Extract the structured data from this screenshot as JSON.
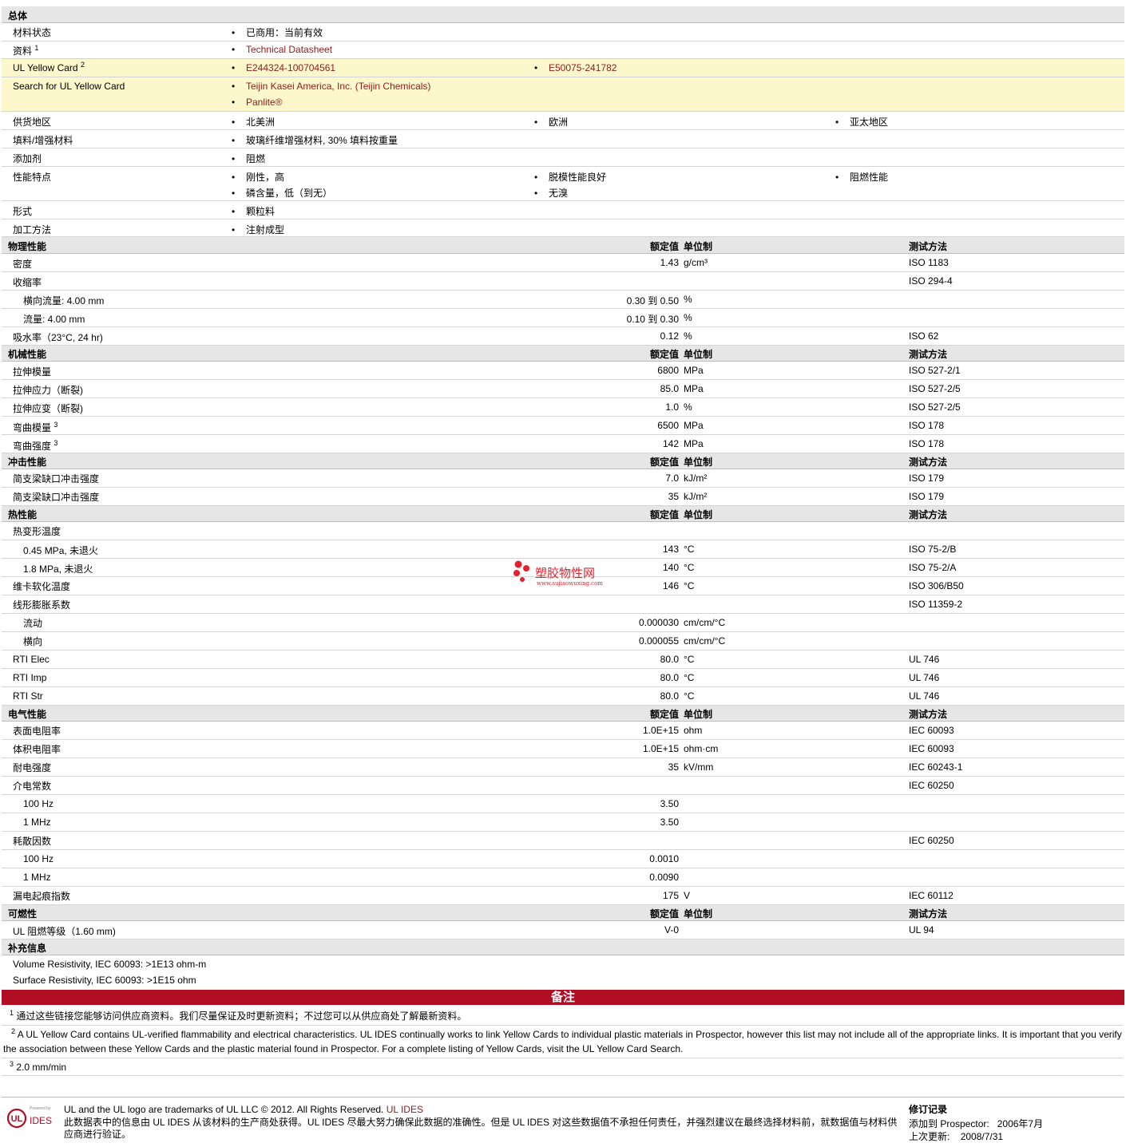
{
  "general": {
    "title": "总体",
    "rows": {
      "status_label": "材料状态",
      "status_val": "已商用：当前有效",
      "data_label": "资料",
      "data_sup": "1",
      "data_val": "Technical Datasheet",
      "yc_label": "UL Yellow Card",
      "yc_sup": "2",
      "yc_val1": "E244324-100704561",
      "yc_val2": "E50075-241782",
      "search_label": "Search for UL Yellow Card",
      "search_val1": "Teijin Kasei America, Inc. (Teijin Chemicals)",
      "search_val2": "Panlite®",
      "region_label": "供货地区",
      "region_1": "北美洲",
      "region_2": "欧洲",
      "region_3": "亚太地区",
      "filler_label": "填料/增强材料",
      "filler_val": "玻璃纤维增强材料, 30% 填料按重量",
      "additive_label": "添加剂",
      "additive_val": "阻燃",
      "features_label": "性能特点",
      "feat_1": "刚性，高",
      "feat_2": "脱模性能良好",
      "feat_3": "阻燃性能",
      "feat_4": "磷含量，低（到无）",
      "feat_5": "无溴",
      "form_label": "形式",
      "form_val": "颗粒料",
      "process_label": "加工方法",
      "process_val": "注射成型"
    }
  },
  "headers": {
    "nominal": "额定值",
    "unit": "单位制",
    "method": "测试方法"
  },
  "physical": {
    "title": "物理性能",
    "density_label": "密度",
    "density_val": "1.43",
    "density_unit": "g/cm³",
    "density_m": "ISO 1183",
    "shrink_label": "收缩率",
    "shrink_m": "ISO 294-4",
    "shrink_t_label": "横向流量: 4.00 mm",
    "shrink_t_val": "0.30 到  0.50",
    "shrink_t_unit": "%",
    "shrink_f_label": "流量: 4.00 mm",
    "shrink_f_val": "0.10 到  0.30",
    "shrink_f_unit": "%",
    "water_label": "吸水率（23°C, 24 hr)",
    "water_val": "0.12",
    "water_unit": "%",
    "water_m": "ISO 62"
  },
  "mechanical": {
    "title": "机械性能",
    "tm_label": "拉伸模量",
    "tm_val": "6800",
    "tm_unit": "MPa",
    "tm_m": "ISO 527-2/1",
    "ts_label": "拉伸应力（断裂)",
    "ts_val": "85.0",
    "ts_unit": "MPa",
    "ts_m": "ISO 527-2/5",
    "te_label": "拉伸应变（断裂)",
    "te_val": "1.0",
    "te_unit": "%",
    "te_m": "ISO 527-2/5",
    "fm_label": "弯曲模量",
    "fm_sup": "3",
    "fm_val": "6500",
    "fm_unit": "MPa",
    "fm_m": "ISO 178",
    "fs_label": "弯曲强度",
    "fs_sup": "3",
    "fs_val": "142",
    "fs_unit": "MPa",
    "fs_m": "ISO 178"
  },
  "impact": {
    "title": "冲击性能",
    "c1_label": "简支梁缺口冲击强度",
    "c1_val": "7.0",
    "c1_unit": "kJ/m²",
    "c1_m": "ISO 179",
    "c2_label": "简支梁缺口冲击强度",
    "c2_val": "35",
    "c2_unit": "kJ/m²",
    "c2_m": "ISO 179"
  },
  "thermal": {
    "title": "热性能",
    "hdt_label": "热变形温度",
    "hdt1_label": "0.45 MPa, 未退火",
    "hdt1_val": "143",
    "hdt1_unit": "°C",
    "hdt1_m": "ISO 75-2/B",
    "hdt2_label": "1.8 MPa, 未退火",
    "hdt2_val": "140",
    "hdt2_unit": "°C",
    "hdt2_m": "ISO 75-2/A",
    "vicat_label": "维卡软化温度",
    "vicat_val": "146",
    "vicat_unit": "°C",
    "vicat_m": "ISO 306/B50",
    "clte_label": "线形膨胀系数",
    "clte_m": "ISO 11359-2",
    "clte_f_label": "流动",
    "clte_f_val": "0.000030",
    "clte_f_unit": "cm/cm/°C",
    "clte_t_label": "横向",
    "clte_t_val": "0.000055",
    "clte_t_unit": "cm/cm/°C",
    "rti_e_label": "RTI Elec",
    "rti_e_val": "80.0",
    "rti_e_unit": "°C",
    "rti_e_m": "UL 746",
    "rti_i_label": "RTI Imp",
    "rti_i_val": "80.0",
    "rti_i_unit": "°C",
    "rti_i_m": "UL 746",
    "rti_s_label": "RTI Str",
    "rti_s_val": "80.0",
    "rti_s_unit": "°C",
    "rti_s_m": "UL 746"
  },
  "electrical": {
    "title": "电气性能",
    "sr_label": "表面电阻率",
    "sr_val": "1.0E+15",
    "sr_unit": "ohm",
    "sr_m": "IEC 60093",
    "vr_label": "体积电阻率",
    "vr_val": "1.0E+15",
    "vr_unit": "ohm·cm",
    "vr_m": "IEC 60093",
    "ds_label": "耐电强度",
    "ds_val": "35",
    "ds_unit": "kV/mm",
    "ds_m": "IEC 60243-1",
    "dc_label": "介电常数",
    "dc_m": "IEC 60250",
    "dc1_label": "100 Hz",
    "dc1_val": "3.50",
    "dc2_label": "1 MHz",
    "dc2_val": "3.50",
    "df_label": "耗散因数",
    "df_m": "IEC 60250",
    "df1_label": "100 Hz",
    "df1_val": "0.0010",
    "df2_label": "1 MHz",
    "df2_val": "0.0090",
    "cti_label": "漏电起痕指数",
    "cti_val": "175",
    "cti_unit": "V",
    "cti_m": "IEC 60112"
  },
  "flammability": {
    "title": "可燃性",
    "ul_label": "UL 阻燃等级（1.60 mm)",
    "ul_val": "V-0",
    "ul_m": "UL 94"
  },
  "supplement": {
    "title": "补充信息",
    "line1": "Volume Resistivity, IEC 60093: >1E13 ohm-m",
    "line2": "Surface Resistivity, IEC 60093: >1E15 ohm"
  },
  "notes": {
    "title": "备注",
    "n1_sup": "1",
    "n1": "通过这些链接您能够访问供应商资料。我们尽量保证及时更新资料；不过您可以从供应商处了解最新资料。",
    "n2_sup": "2",
    "n2": "A UL Yellow Card contains UL-verified flammability and electrical characteristics. UL IDES continually works to link Yellow Cards to individual plastic materials in Prospector, however this list may not include all of the appropriate links. It is important that you verify the association between these Yellow Cards and the plastic material found in Prospector. For a complete listing of Yellow Cards, visit the UL Yellow Card Search.",
    "n3_sup": "3",
    "n3": "2.0 mm/min"
  },
  "footer": {
    "logo_small": "Powered by",
    "logo_ul": "UL",
    "logo_ides": "IDES",
    "trademark": "UL and the UL logo are trademarks of UL LLC © 2012. All Rights Reserved.",
    "ul_ides_link": "UL IDES",
    "disclaimer": "此数据表中的信息由  UL IDES 从该材料的生产商处获得。UL IDES 尽最大努力确保此数据的准确性。但是  UL IDES 对这些数据值不承担任何责任，并强烈建议在最终选择材料前，就数据值与材料供应商进行验证。",
    "rev_title": "修订记录",
    "added_label": "添加到  Prospector:",
    "added_val": "2006年7月",
    "updated_label": "上次更新:",
    "updated_val": "2008/7/31"
  },
  "watermark": {
    "text": "塑胶物性网",
    "url": "www.sujiaowuxing.com"
  }
}
